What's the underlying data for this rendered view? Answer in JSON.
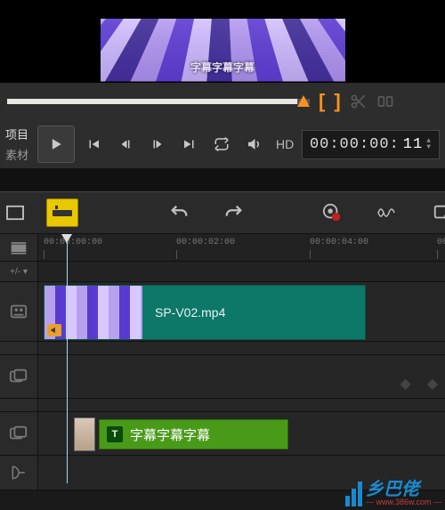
{
  "preview": {
    "overlay_text": "字幕字幕字幕"
  },
  "transport": {
    "mode_project": "项目",
    "mode_clip": "素材",
    "hd_label": "HD",
    "timecode": "00:00:00:",
    "timecode_frames": "11"
  },
  "ruler": {
    "t0": "00:00:00:00",
    "t1": "00:00:02:00",
    "t2": "00:00:04:00",
    "t3": "00"
  },
  "zoom_label": "+/- ▾",
  "clips": {
    "video_label": "SP-V02.mp4",
    "title_badge": "T",
    "title_text": "字幕字幕字幕"
  },
  "watermark": {
    "main": "乡巴佬",
    "sub": "--- www.386w.com ---"
  }
}
